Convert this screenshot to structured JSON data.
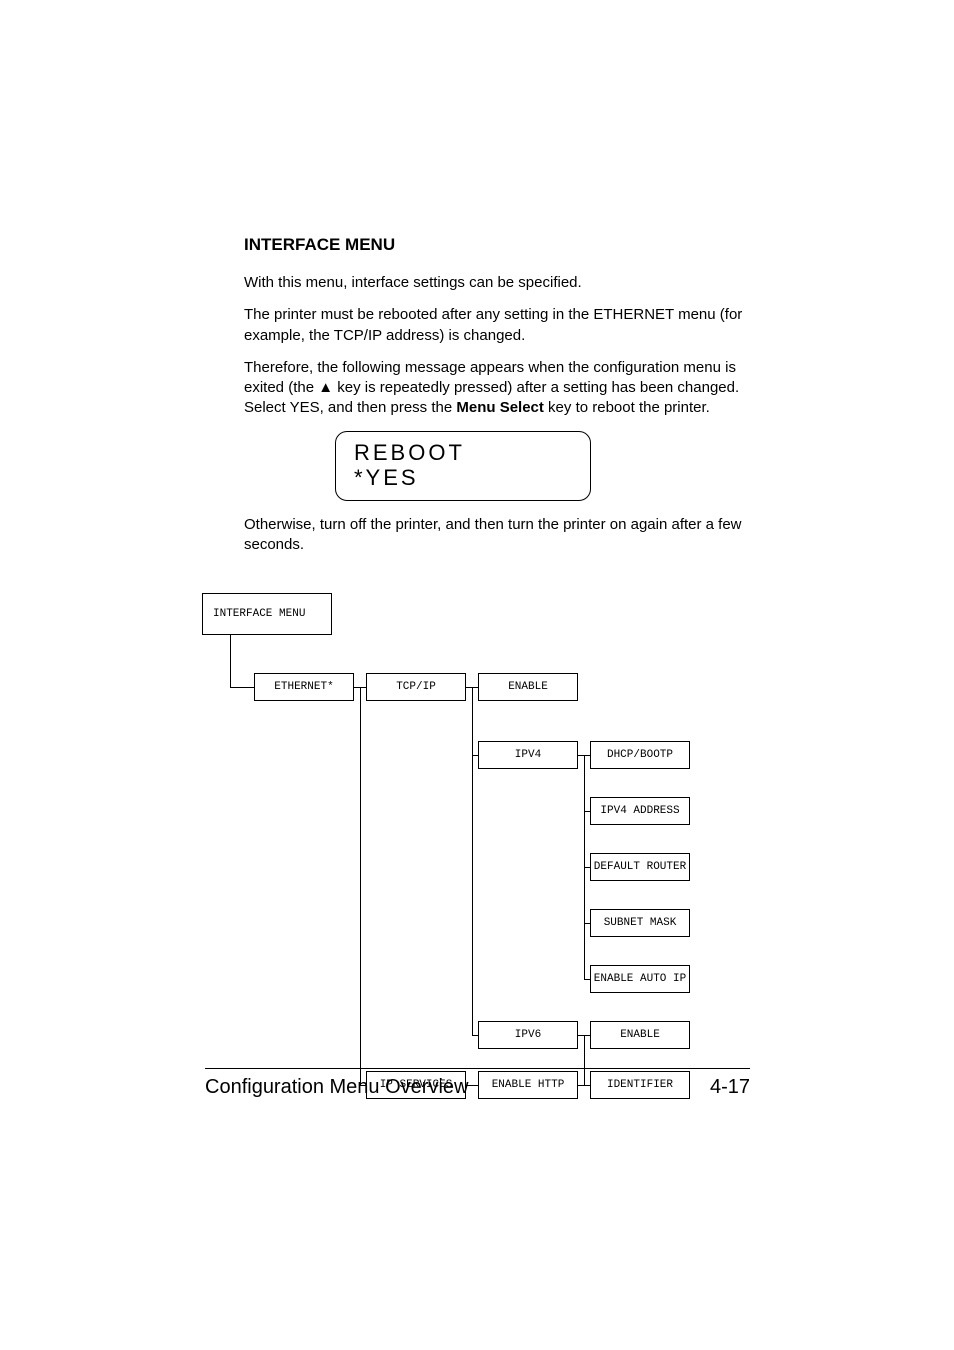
{
  "heading": "INTERFACE MENU",
  "para1": "With this menu, interface settings can be specified.",
  "para2": "The printer must be rebooted after any setting in the ETHERNET menu (for example, the TCP/IP address) is changed.",
  "para3_pre": "Therefore, the following message appears when the configuration menu is exited (the ▲ key is repeatedly pressed) after a setting has been changed. Select YES, and then press the ",
  "para3_bold": "Menu Select",
  "para3_post": " key to reboot the printer.",
  "display": {
    "line1": "REBOOT",
    "line2": "*YES"
  },
  "para4": "Otherwise, turn off the printer, and then turn the printer on again after a few seconds.",
  "tree": {
    "root": "INTERFACE MENU",
    "ethernet": "ETHERNET*",
    "tcpip": "TCP/IP",
    "enable1": "ENABLE",
    "ipv4": "IPV4",
    "dhcp": "DHCP/BOOTP",
    "ipv4addr": "IPV4 ADDRESS",
    "defroute": "DEFAULT ROUTER",
    "subnet": "SUBNET MASK",
    "autoip": "ENABLE AUTO IP",
    "ipv6": "IPV6",
    "enable2": "ENABLE",
    "ipservices": "IP SERVICES",
    "enablehttp": "ENABLE HTTP",
    "identifier": "IDENTIFIER"
  },
  "footer": {
    "title": "Configuration Menu Overview",
    "page": "4-17"
  }
}
